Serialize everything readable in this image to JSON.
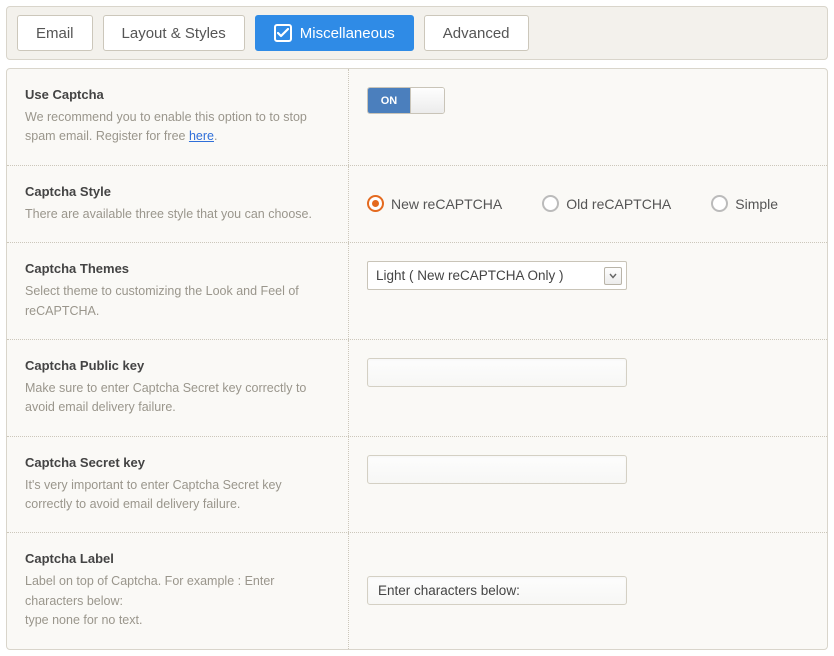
{
  "tabs": {
    "email": "Email",
    "layout": "Layout & Styles",
    "misc": "Miscellaneous",
    "advanced": "Advanced"
  },
  "rows": {
    "useCaptcha": {
      "title": "Use Captcha",
      "desc_pre": "We recommend you to enable this option to to stop spam email. Register for free ",
      "desc_link": "here",
      "desc_post": "."
    },
    "style": {
      "title": "Captcha Style",
      "desc": "There are available three style that you can choose.",
      "options": {
        "new": "New reCAPTCHA",
        "old": "Old reCAPTCHA",
        "simple": "Simple"
      }
    },
    "themes": {
      "title": "Captcha Themes",
      "desc": "Select theme to customizing the Look and Feel of reCAPTCHA.",
      "selected": "Light ( New reCAPTCHA Only )"
    },
    "pubkey": {
      "title": "Captcha Public key",
      "desc": "Make sure to enter Captcha Secret key correctly to avoid email delivery failure.",
      "value": ""
    },
    "seckey": {
      "title": "Captcha Secret key",
      "desc": "It's very important to enter Captcha Secret key correctly to avoid email delivery failure.",
      "value": ""
    },
    "label": {
      "title": "Captcha Label",
      "desc_l1": "Label on top of Captcha. For example : Enter characters below:",
      "desc_l2": "type none for no text.",
      "value": "Enter characters below:"
    }
  },
  "toggle": {
    "on": "ON"
  }
}
